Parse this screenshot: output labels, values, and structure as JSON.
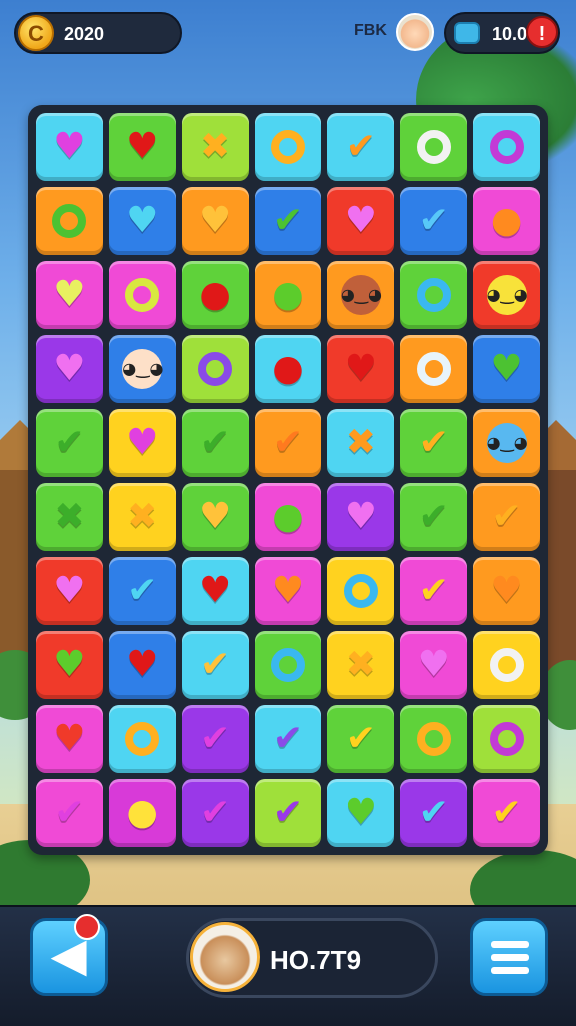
{
  "hud": {
    "coins": "2020",
    "coin_symbol": "C",
    "social_label": "FBK",
    "lives": "10.00",
    "alert_symbol": "!"
  },
  "footer": {
    "score": "HO.7T9",
    "back_symbol": "◀"
  },
  "colors": {
    "cyan": "#4fd5f2",
    "green": "#5fd23a",
    "lime": "#9fe03a",
    "yellow": "#ffd21f",
    "orange": "#ff9a1f",
    "red": "#f03a2a",
    "pink": "#f04ad6",
    "purple": "#9a38e8",
    "blue": "#2f7fe8",
    "magenta": "#d83ad8"
  },
  "board": {
    "rows": [
      [
        {
          "bg": "cyan",
          "icon": "heart",
          "ic": "#e040e0"
        },
        {
          "bg": "green",
          "icon": "heart",
          "ic": "#e01818"
        },
        {
          "bg": "lime",
          "icon": "cross",
          "ic": "#ffb020"
        },
        {
          "bg": "cyan",
          "icon": "ring",
          "ic": "#ffb020"
        },
        {
          "bg": "cyan",
          "icon": "check",
          "ic": "#ff9a1f"
        },
        {
          "bg": "green",
          "icon": "ring",
          "ic": "#f2f2f2"
        },
        {
          "bg": "cyan",
          "icon": "ring",
          "ic": "#c23ad6"
        }
      ],
      [
        {
          "bg": "orange",
          "icon": "ring",
          "ic": "#4cc232"
        },
        {
          "bg": "blue",
          "icon": "heart",
          "ic": "#4fd5f2"
        },
        {
          "bg": "orange",
          "icon": "heart",
          "ic": "#ffc23a"
        },
        {
          "bg": "blue",
          "icon": "check",
          "ic": "#4cc232"
        },
        {
          "bg": "red",
          "icon": "heart",
          "ic": "#f070f0"
        },
        {
          "bg": "blue",
          "icon": "check",
          "ic": "#58c8f8"
        },
        {
          "bg": "pink",
          "icon": "apple",
          "ic": "#ff8a1f"
        }
      ],
      [
        {
          "bg": "pink",
          "icon": "heart",
          "ic": "#e8f060"
        },
        {
          "bg": "pink",
          "icon": "ring",
          "ic": "#d8e840"
        },
        {
          "bg": "green",
          "icon": "apple",
          "ic": "#e01818"
        },
        {
          "bg": "orange",
          "icon": "apple",
          "ic": "#5ccc2c"
        },
        {
          "bg": "orange",
          "icon": "face",
          "ic": "#c0603a"
        },
        {
          "bg": "green",
          "icon": "ring",
          "ic": "#3ab8f0"
        },
        {
          "bg": "red",
          "icon": "face",
          "ic": "#f8e23a"
        }
      ],
      [
        {
          "bg": "purple",
          "icon": "heart",
          "ic": "#f070f0"
        },
        {
          "bg": "blue",
          "icon": "face",
          "ic": "#fde0c8"
        },
        {
          "bg": "lime",
          "icon": "ring",
          "ic": "#8a4ae8"
        },
        {
          "bg": "cyan",
          "icon": "apple",
          "ic": "#e01818"
        },
        {
          "bg": "red",
          "icon": "heart",
          "ic": "#e01818"
        },
        {
          "bg": "orange",
          "icon": "ring",
          "ic": "#e8f4fb"
        },
        {
          "bg": "blue",
          "icon": "heart",
          "ic": "#4cc232"
        }
      ],
      [
        {
          "bg": "green",
          "icon": "check",
          "ic": "#3cae2a"
        },
        {
          "bg": "yellow",
          "icon": "heart",
          "ic": "#e040e0"
        },
        {
          "bg": "green",
          "icon": "check",
          "ic": "#3cae2a"
        },
        {
          "bg": "orange",
          "icon": "check",
          "ic": "#ff7a1f"
        },
        {
          "bg": "cyan",
          "icon": "cross",
          "ic": "#ff9a1f"
        },
        {
          "bg": "green",
          "icon": "check",
          "ic": "#ffb020"
        },
        {
          "bg": "orange",
          "icon": "face",
          "ic": "#58b8f0"
        }
      ],
      [
        {
          "bg": "green",
          "icon": "cross",
          "ic": "#3cae2a"
        },
        {
          "bg": "yellow",
          "icon": "cross",
          "ic": "#ffb020"
        },
        {
          "bg": "green",
          "icon": "heart",
          "ic": "#ffc23a"
        },
        {
          "bg": "pink",
          "icon": "apple",
          "ic": "#5ccc2c"
        },
        {
          "bg": "purple",
          "icon": "heart",
          "ic": "#f070f0"
        },
        {
          "bg": "green",
          "icon": "check",
          "ic": "#3cae2a"
        },
        {
          "bg": "orange",
          "icon": "check",
          "ic": "#ffb020"
        }
      ],
      [
        {
          "bg": "red",
          "icon": "heart",
          "ic": "#f070f0"
        },
        {
          "bg": "blue",
          "icon": "check",
          "ic": "#4fd5f2"
        },
        {
          "bg": "cyan",
          "icon": "heart",
          "ic": "#e01818"
        },
        {
          "bg": "pink",
          "icon": "heart",
          "ic": "#ff8a1f"
        },
        {
          "bg": "yellow",
          "icon": "ring",
          "ic": "#3ab8f0"
        },
        {
          "bg": "pink",
          "icon": "check",
          "ic": "#ffd21f"
        },
        {
          "bg": "orange",
          "icon": "heart",
          "ic": "#ff8a1f"
        }
      ],
      [
        {
          "bg": "red",
          "icon": "heart",
          "ic": "#5ccc2c"
        },
        {
          "bg": "blue",
          "icon": "heart",
          "ic": "#e01818"
        },
        {
          "bg": "cyan",
          "icon": "check",
          "ic": "#ffc23a"
        },
        {
          "bg": "green",
          "icon": "ring",
          "ic": "#3ab8f0"
        },
        {
          "bg": "yellow",
          "icon": "cross",
          "ic": "#ffb020"
        },
        {
          "bg": "pink",
          "icon": "heart",
          "ic": "#f070f0"
        },
        {
          "bg": "yellow",
          "icon": "ring",
          "ic": "#f2f2f2"
        }
      ],
      [
        {
          "bg": "pink",
          "icon": "heart",
          "ic": "#f03a2a"
        },
        {
          "bg": "cyan",
          "icon": "ring",
          "ic": "#ffb020"
        },
        {
          "bg": "purple",
          "icon": "check",
          "ic": "#e040e0"
        },
        {
          "bg": "cyan",
          "icon": "check",
          "ic": "#8a4ae8"
        },
        {
          "bg": "green",
          "icon": "check",
          "ic": "#ffd21f"
        },
        {
          "bg": "green",
          "icon": "ring",
          "ic": "#ffb020"
        },
        {
          "bg": "lime",
          "icon": "ring",
          "ic": "#c23ad6"
        }
      ],
      [
        {
          "bg": "pink",
          "icon": "check",
          "ic": "#e040e0"
        },
        {
          "bg": "magenta",
          "icon": "apple",
          "ic": "#ffe23a"
        },
        {
          "bg": "purple",
          "icon": "check",
          "ic": "#e040e0"
        },
        {
          "bg": "lime",
          "icon": "check",
          "ic": "#9a38e8"
        },
        {
          "bg": "cyan",
          "icon": "heart",
          "ic": "#5ccc2c"
        },
        {
          "bg": "purple",
          "icon": "check",
          "ic": "#4fd5f2"
        },
        {
          "bg": "pink",
          "icon": "check",
          "ic": "#ffd21f"
        }
      ]
    ]
  }
}
